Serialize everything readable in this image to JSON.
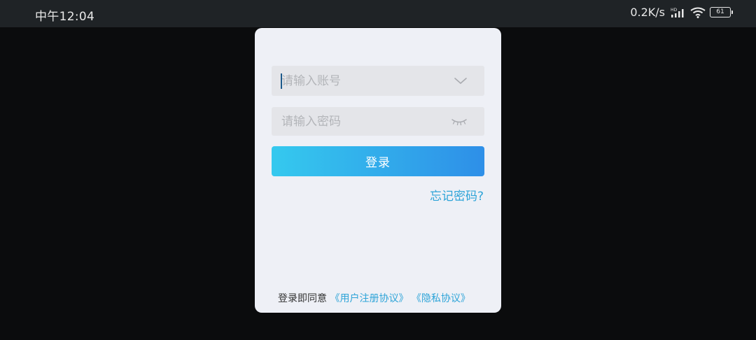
{
  "status_bar": {
    "time": "中午12:04",
    "network_speed": "0.2K/s",
    "battery_level": "61"
  },
  "login_form": {
    "account_placeholder": "请输入账号",
    "password_placeholder": "请输入密码",
    "login_label": "登录",
    "forgot_password": "忘记密码?"
  },
  "agreement": {
    "prefix": "登录即同意",
    "user_agreement": "《用户注册协议》",
    "privacy_policy": "《隐私协议》"
  },
  "colors": {
    "accent_start": "#35c9ee",
    "accent_end": "#2e8fe8",
    "link": "#2ea4d8",
    "dialog_background": "#eef0f6"
  }
}
